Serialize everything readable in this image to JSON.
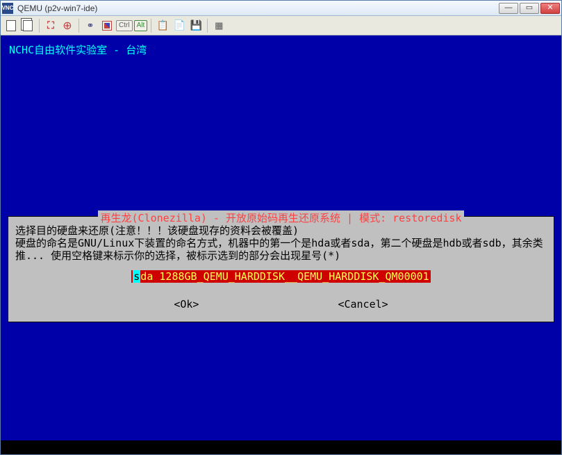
{
  "window": {
    "title": "QEMU (p2v-win7-ide)"
  },
  "screen": {
    "header_line": "NCHC自由软件实验室 - 台湾"
  },
  "dialog": {
    "title": "再生龙(Clonezilla) - 开放原始码再生还原系统 | 模式: restoredisk",
    "line1": "选择目的硬盘来还原(注意！！！该硬盘现存的资料会被覆盖)",
    "line2": "硬盘的命名是GNU/Linux下装置的命名方式，机器中的第一个是hda或者sda，第二个硬盘是hdb或者sdb，其余类推... 使用空格键来标示你的选择，被标示选到的部分会出现星号(*)",
    "disk_cursor": "s",
    "disk_label": "da 1288GB_QEMU_HARDDISK__QEMU_HARDDISK_QM00001",
    "ok": "<Ok>",
    "cancel": "<Cancel>"
  }
}
